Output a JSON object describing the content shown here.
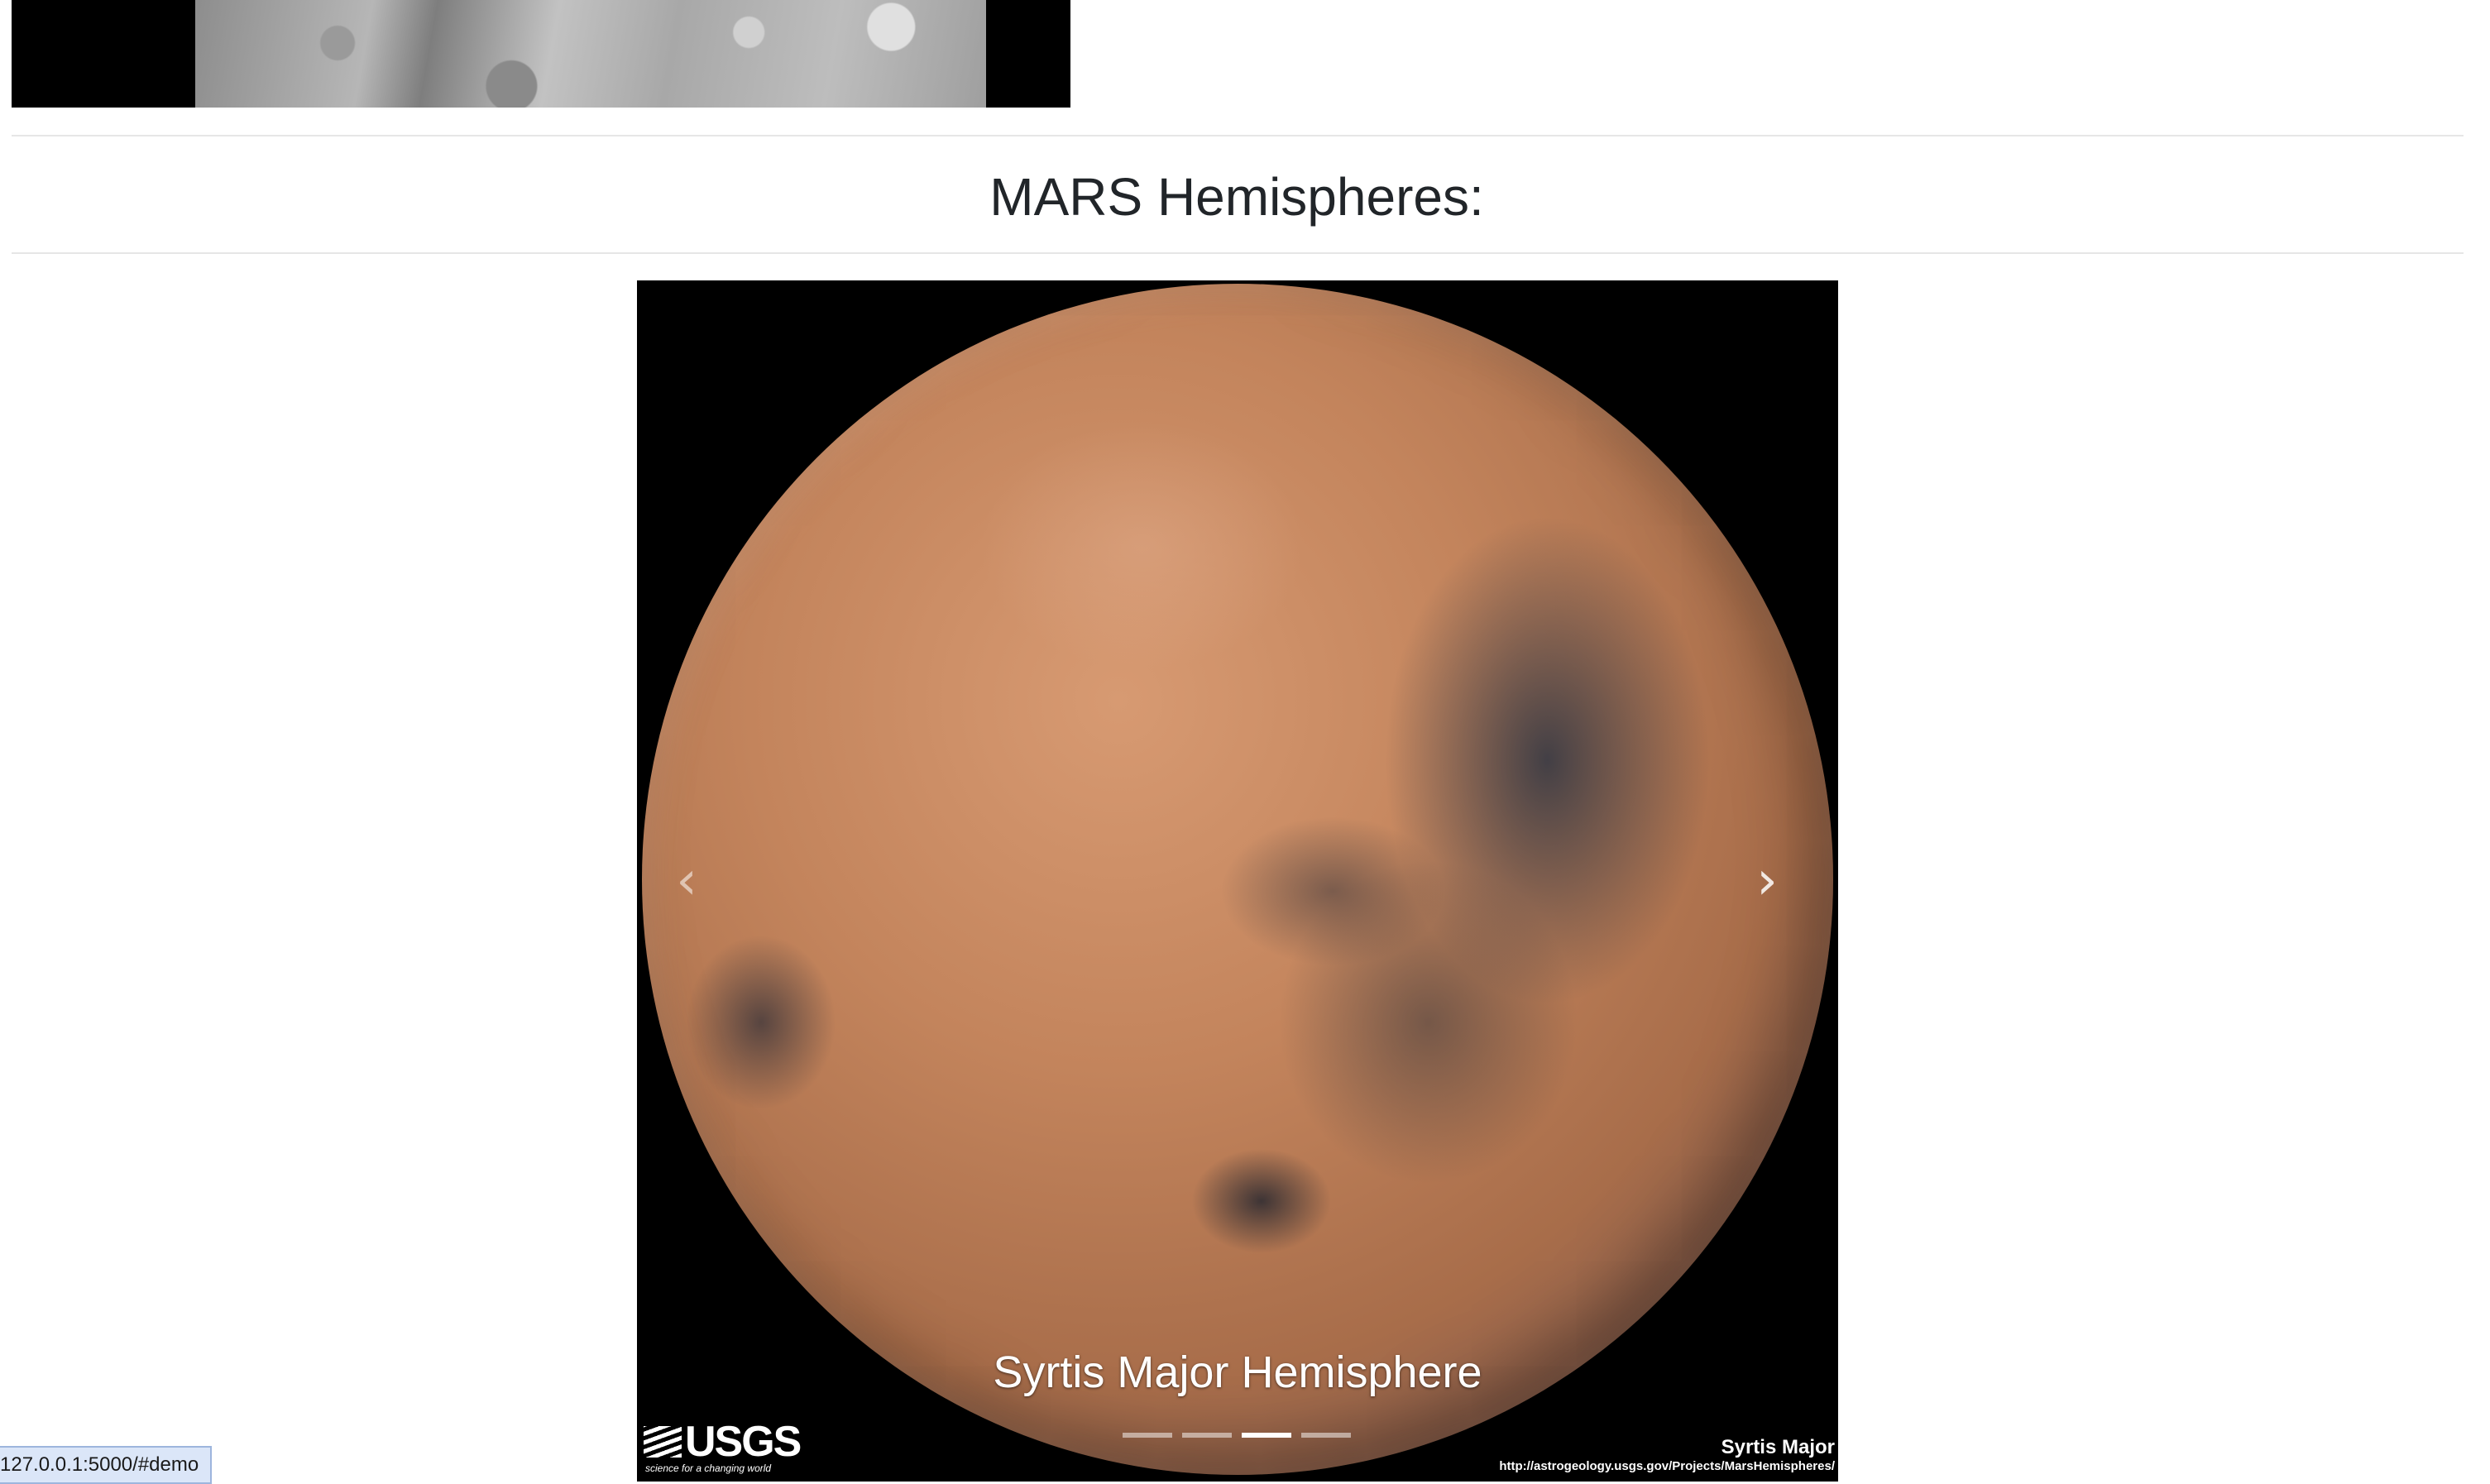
{
  "section": {
    "title": "MARS Hemispheres:"
  },
  "carousel": {
    "caption": "Syrtis Major Hemisphere",
    "prev_icon": "chevron-left-icon",
    "next_icon": "chevron-right-icon",
    "prev_glyph": "‹",
    "next_glyph": "›",
    "slide_count": 4,
    "active_index": 2,
    "image": {
      "logo_text": "USGS",
      "logo_tagline": "science for a changing world",
      "credit_name": "Syrtis Major",
      "credit_url": "http://astrogeology.usgs.gov/Projects/MarsHemispheres/"
    }
  },
  "status_bar": {
    "url": "127.0.0.1:5000/#demo"
  }
}
